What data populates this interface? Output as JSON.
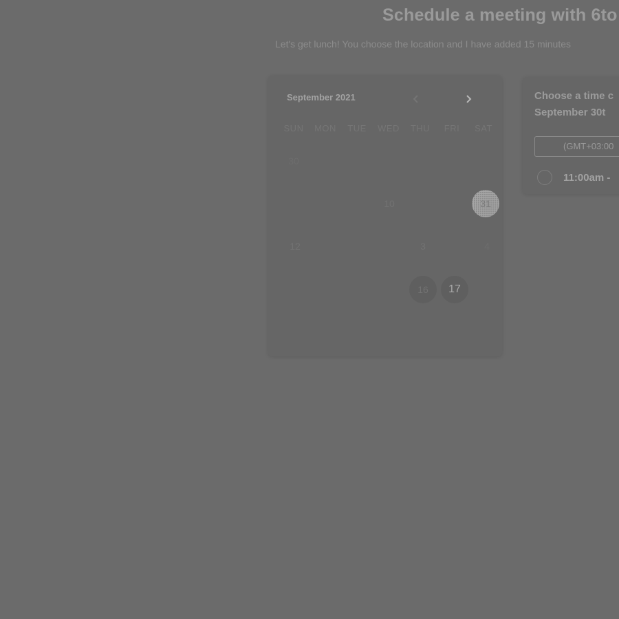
{
  "header": {
    "title": "Schedule a meeting with 6to",
    "subtitle": "Let's get lunch! You choose the location and I have added 15 minutes"
  },
  "calendar": {
    "month_label": "September 2021",
    "prev_icon": "chevron-left-icon",
    "next_icon": "chevron-right-icon",
    "weekdays": [
      "SUN",
      "MON",
      "TUE",
      "WED",
      "THU",
      "FRI",
      "SAT"
    ],
    "days": [
      "30",
      "10",
      "31",
      "12",
      "3",
      "4",
      "16",
      "17"
    ],
    "today": "17",
    "selected": "31"
  },
  "time_panel": {
    "heading_line1": "Choose a time c",
    "heading_line2": "September 30t",
    "timezone": "(GMT+03:00",
    "slot_label": "11:00am -"
  }
}
